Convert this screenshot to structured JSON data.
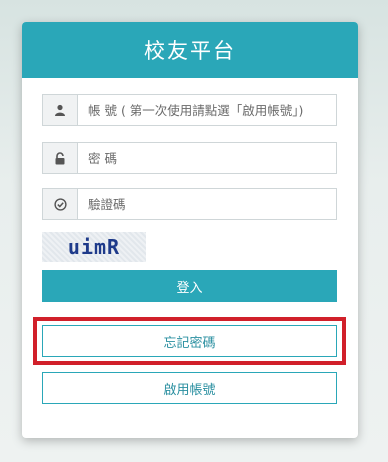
{
  "header": {
    "title": "校友平台"
  },
  "fields": {
    "account_placeholder": "帳 號 ( 第一次使用請點選「啟用帳號」)",
    "password_placeholder": "密 碼",
    "captcha_placeholder": "驗證碼"
  },
  "captcha": {
    "text": "uimR"
  },
  "buttons": {
    "login": "登入",
    "forgot_password": "忘記密碼",
    "activate_account": "啟用帳號"
  },
  "icons": {
    "account": "user-icon",
    "password": "lock-icon",
    "captcha": "check-circle-icon"
  },
  "colors": {
    "accent": "#2aa7b8",
    "highlight": "#d1202a"
  }
}
